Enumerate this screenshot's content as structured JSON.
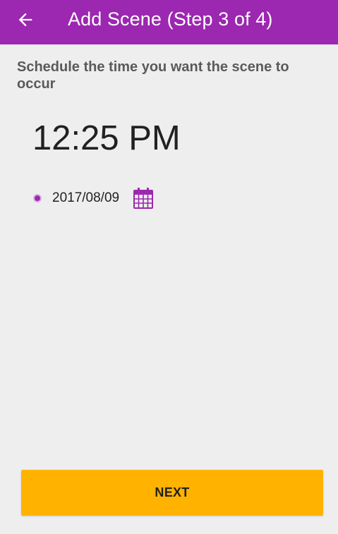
{
  "app_bar": {
    "title": "Add Scene (Step 3 of 4)",
    "back_icon": "arrow-left-icon",
    "background_color": "#9C27B0"
  },
  "schedule": {
    "prompt": "Schedule the time you want the scene to occur",
    "time": "12:25 PM",
    "date": "2017/08/09",
    "calendar_icon": "calendar-icon",
    "accent_color": "#9C27B0"
  },
  "footer": {
    "next_label": "NEXT",
    "button_color": "#FFB300"
  }
}
